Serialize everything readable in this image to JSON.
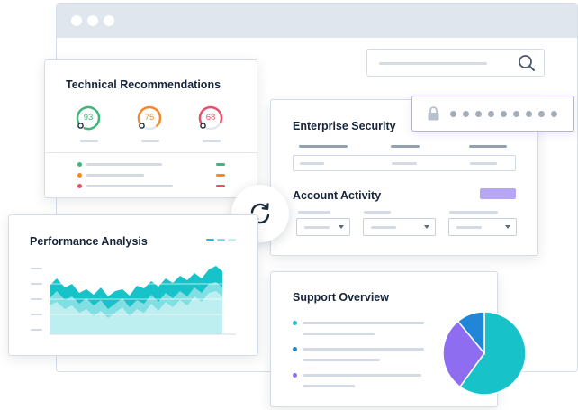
{
  "colors": {
    "teal": "#17c3c8",
    "teal_light": "#bdeef0",
    "teal_mid": "#7fdfe3",
    "green": "#3fb77a",
    "orange": "#f08a2b",
    "red": "#e6506a",
    "purple": "#8f6df0",
    "blue": "#1f86d8",
    "lavender": "#b7a6f3"
  },
  "technical_recommendations": {
    "title": "Technical Recommendations",
    "gauges": [
      {
        "value": "93",
        "color": "#3fb77a",
        "level": 0.93
      },
      {
        "value": "75",
        "color": "#f08a2b",
        "level": 0.75
      },
      {
        "value": "68",
        "color": "#e6506a",
        "level": 0.68
      }
    ]
  },
  "enterprise_security": {
    "title": "Enterprise Security"
  },
  "account_activity": {
    "title": "Account Activity"
  },
  "performance_analysis": {
    "title": "Performance Analysis"
  },
  "support_overview": {
    "title": "Support Overview",
    "pie": [
      {
        "color": "#17c3c8",
        "share": 0.6
      },
      {
        "color": "#8f6df0",
        "share": 0.29
      },
      {
        "color": "#1f86d8",
        "share": 0.11
      }
    ]
  },
  "icons": {
    "search": "search-icon",
    "lock": "lock-icon",
    "sync": "sync-icon"
  }
}
